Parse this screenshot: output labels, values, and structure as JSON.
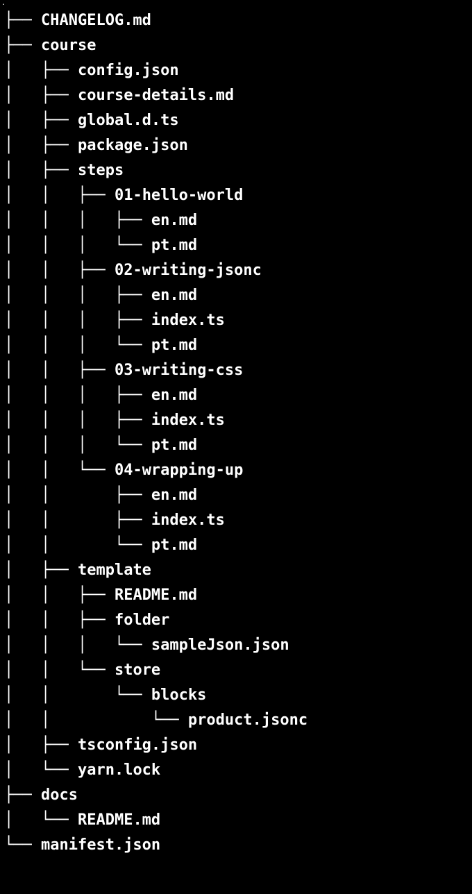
{
  "tree": {
    "lines": [
      {
        "prefix": "├── ",
        "name": "CHANGELOG.md"
      },
      {
        "prefix": "├── ",
        "name": "course"
      },
      {
        "prefix": "│   ├── ",
        "name": "config.json"
      },
      {
        "prefix": "│   ├── ",
        "name": "course-details.md"
      },
      {
        "prefix": "│   ├── ",
        "name": "global.d.ts"
      },
      {
        "prefix": "│   ├── ",
        "name": "package.json"
      },
      {
        "prefix": "│   ├── ",
        "name": "steps"
      },
      {
        "prefix": "│   │   ├── ",
        "name": "01-hello-world"
      },
      {
        "prefix": "│   │   │   ├── ",
        "name": "en.md"
      },
      {
        "prefix": "│   │   │   └── ",
        "name": "pt.md"
      },
      {
        "prefix": "│   │   ├── ",
        "name": "02-writing-jsonc"
      },
      {
        "prefix": "│   │   │   ├── ",
        "name": "en.md"
      },
      {
        "prefix": "│   │   │   ├── ",
        "name": "index.ts"
      },
      {
        "prefix": "│   │   │   └── ",
        "name": "pt.md"
      },
      {
        "prefix": "│   │   ├── ",
        "name": "03-writing-css"
      },
      {
        "prefix": "│   │   │   ├── ",
        "name": "en.md"
      },
      {
        "prefix": "│   │   │   ├── ",
        "name": "index.ts"
      },
      {
        "prefix": "│   │   │   └── ",
        "name": "pt.md"
      },
      {
        "prefix": "│   │   └── ",
        "name": "04-wrapping-up"
      },
      {
        "prefix": "│   │       ├── ",
        "name": "en.md"
      },
      {
        "prefix": "│   │       ├── ",
        "name": "index.ts"
      },
      {
        "prefix": "│   │       └── ",
        "name": "pt.md"
      },
      {
        "prefix": "│   ├── ",
        "name": "template"
      },
      {
        "prefix": "│   │   ├── ",
        "name": "README.md"
      },
      {
        "prefix": "│   │   ├── ",
        "name": "folder"
      },
      {
        "prefix": "│   │   │   └── ",
        "name": "sampleJson.json"
      },
      {
        "prefix": "│   │   └── ",
        "name": "store"
      },
      {
        "prefix": "│   │       └── ",
        "name": "blocks"
      },
      {
        "prefix": "│   │           └── ",
        "name": "product.jsonc"
      },
      {
        "prefix": "│   ├── ",
        "name": "tsconfig.json"
      },
      {
        "prefix": "│   └── ",
        "name": "yarn.lock"
      },
      {
        "prefix": "├── ",
        "name": "docs"
      },
      {
        "prefix": "│   └── ",
        "name": "README.md"
      },
      {
        "prefix": "└── ",
        "name": "manifest.json"
      }
    ]
  },
  "dot": "."
}
